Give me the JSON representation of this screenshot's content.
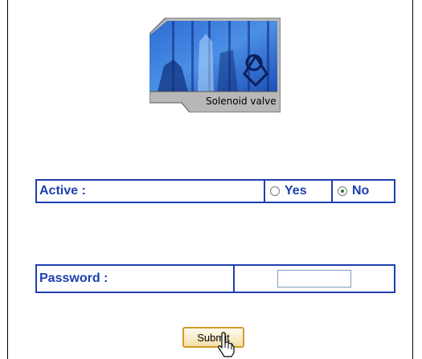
{
  "header": {
    "caption": "Solenoid valve"
  },
  "active_row": {
    "label": "Active :",
    "options": [
      {
        "label": "Yes",
        "checked": false
      },
      {
        "label": "No",
        "checked": true
      }
    ]
  },
  "password_row": {
    "label": "Password :",
    "value": ""
  },
  "submit": {
    "label": "Submit"
  },
  "colors": {
    "accent": "#1d3fb0",
    "button_border": "#d49a2a"
  }
}
